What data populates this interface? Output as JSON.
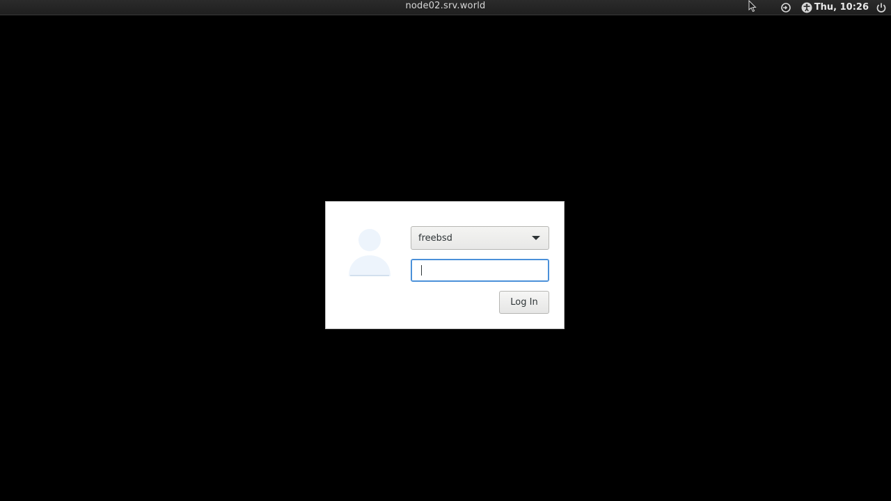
{
  "topbar": {
    "hostname": "node02.srv.world",
    "clock": "Thu, 10:26",
    "icons": [
      "session-icon",
      "accessibility-icon",
      "power-icon"
    ]
  },
  "login": {
    "user_selected": "freebsd",
    "password_value": "",
    "password_placeholder": "",
    "login_label": "Log In"
  },
  "colors": {
    "background": "#000000",
    "focus_accent": "#4a90d9",
    "avatar": "#edf4fc"
  }
}
